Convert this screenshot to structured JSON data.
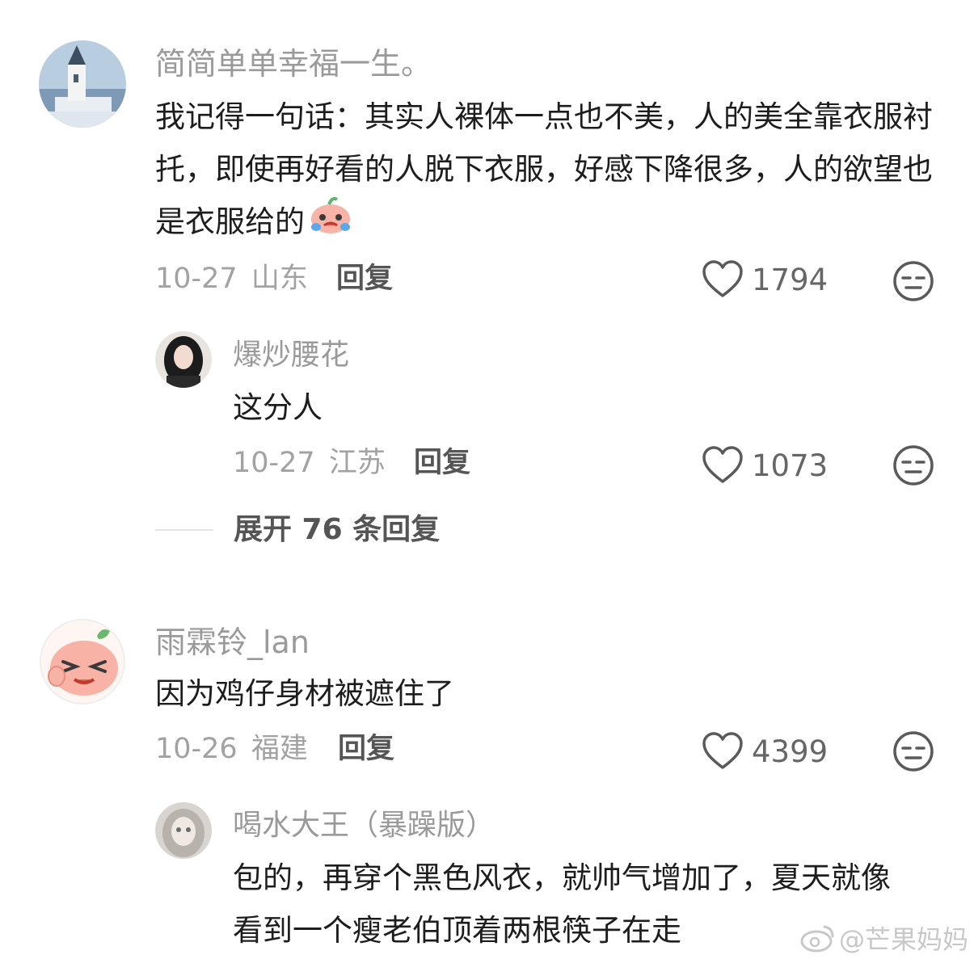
{
  "comments": [
    {
      "username": "简简单单幸福一生。",
      "text": "我记得一句话：其实人裸体一点也不美，人的美全靠衣服衬托，即使再好看的人脱下衣服，好感下降很多，人的欲望也是衣服给的",
      "date": "10-27",
      "location": "山东",
      "reply_label": "回复",
      "likes": "1794",
      "replies": [
        {
          "username": "爆炒腰花",
          "text": "这分人",
          "date": "10-27",
          "location": "江苏",
          "reply_label": "回复",
          "likes": "1073"
        }
      ],
      "expand_label": "展开 76 条回复"
    },
    {
      "username": "雨霖铃_lan",
      "text": "因为鸡仔身材被遮住了",
      "date": "10-26",
      "location": "福建",
      "reply_label": "回复",
      "likes": "4399",
      "replies": [
        {
          "username": "喝水大王（暴躁版）",
          "text": "包的，再穿个黑色风衣，就帅气增加了，夏天就像看到一个瘦老伯顶着两根筷子在走"
        }
      ]
    }
  ],
  "watermark": "@芒果妈妈",
  "colors": {
    "username": "#9a9a9a",
    "meta": "#a2a2a2",
    "text": "#1d1d1d",
    "icon": "#5a5a5a"
  }
}
